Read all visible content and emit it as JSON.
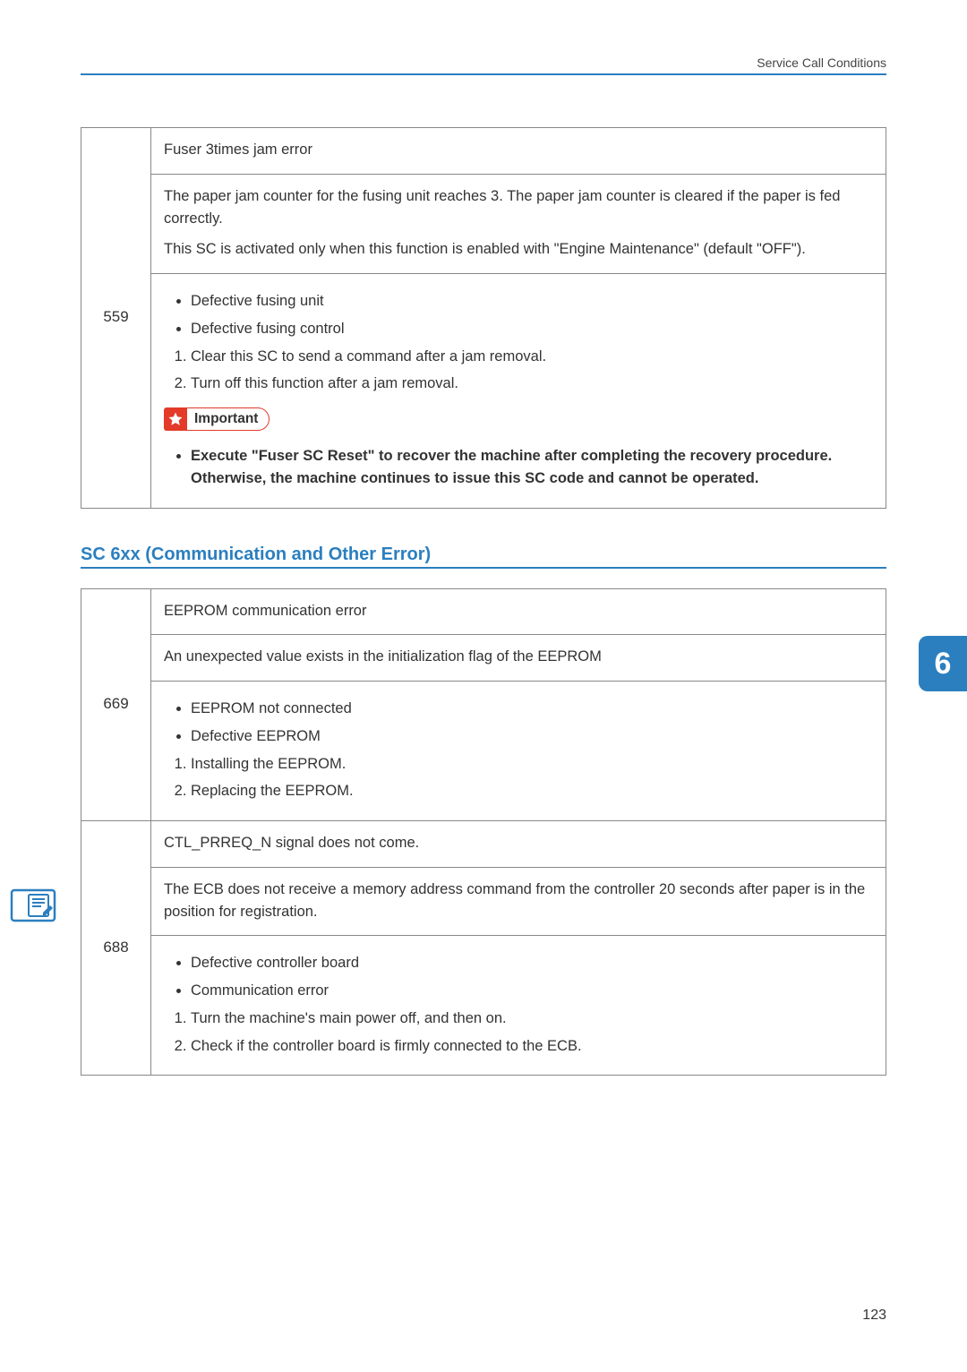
{
  "header": {
    "section_title": "Service Call Conditions"
  },
  "chapter_badge": "6",
  "page_number": "123",
  "section_heading": "SC 6xx (Communication and Other Error)",
  "important_label": "Important",
  "table559": {
    "code": "559",
    "title": "Fuser 3times jam error",
    "desc_p1": "The paper jam counter for the fusing unit reaches 3. The paper jam counter is cleared if the paper is fed correctly.",
    "desc_p2": "This SC is activated only when this function is enabled with \"Engine Maintenance\" (default \"OFF\").",
    "bullets": [
      "Defective fusing unit",
      "Defective fusing control"
    ],
    "steps": [
      "Clear this SC to send a command after a jam removal.",
      "Turn off this function after a jam removal."
    ],
    "important_note": "Execute \"Fuser SC Reset\" to recover the machine after completing the recovery procedure. Otherwise, the machine continues to issue this SC code and cannot be operated."
  },
  "table669": {
    "code": "669",
    "title": "EEPROM communication error",
    "desc": "An unexpected value exists in the initialization flag of the EEPROM",
    "bullets": [
      "EEPROM not connected",
      "Defective EEPROM"
    ],
    "steps": [
      "Installing the EEPROM.",
      "Replacing the EEPROM."
    ]
  },
  "table688": {
    "code": "688",
    "title": "CTL_PRREQ_N signal does not come.",
    "desc": "The ECB does not receive a memory address command from the controller 20 seconds after paper is in the position for registration.",
    "bullets": [
      "Defective controller board",
      "Communication error"
    ],
    "steps": [
      "Turn the machine's main power off, and then on.",
      "Check if the controller board is firmly connected to the ECB."
    ]
  }
}
